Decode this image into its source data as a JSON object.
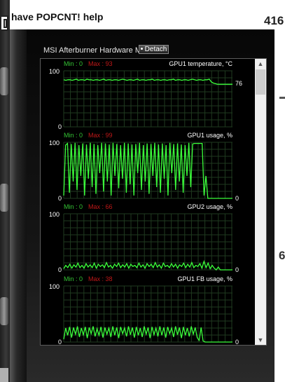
{
  "page": {
    "title": "have POPCNT! help",
    "page_number": "416",
    "side_mark": "6"
  },
  "monitor": {
    "title": "MSI Afterburner Hardware Monitor",
    "detach_label": "Detach",
    "colors": {
      "line": "#3bff3b",
      "grid": "#1f3a1f",
      "min_text": "#34c334",
      "max_text": "#c01818",
      "label": "#ffffff"
    }
  },
  "chart_data": [
    {
      "type": "line",
      "title": "GPU1 temperature, °C",
      "min_label": "Min : 0",
      "max_label": "Max : 93",
      "y_top_label": "100",
      "y_bottom_label": "0",
      "current_value_label": "76",
      "ylim": [
        0,
        100
      ],
      "values": [
        84,
        83,
        84,
        84,
        83,
        84,
        85,
        83,
        84,
        84,
        83,
        85,
        84,
        84,
        83,
        84,
        84,
        83,
        84,
        85,
        83,
        84,
        84,
        83,
        84,
        84,
        83,
        84,
        85,
        84,
        83,
        84,
        84,
        83,
        84,
        85,
        83,
        84,
        84,
        83,
        84,
        84,
        85,
        83,
        84,
        84,
        83,
        84,
        84,
        83,
        84,
        84,
        85,
        83,
        84,
        84,
        83,
        84,
        84,
        83,
        84,
        85,
        84,
        83,
        84,
        84,
        83,
        84,
        84,
        85,
        80,
        78,
        77,
        76,
        76,
        76,
        76,
        76,
        76,
        76,
        76
      ]
    },
    {
      "type": "line",
      "title": "GPU1 usage, %",
      "min_label": "Min : 0",
      "max_label": "Max : 99",
      "y_top_label": "100",
      "y_bottom_label": "0",
      "current_value_label": "0",
      "ylim": [
        0,
        100
      ],
      "values": [
        5,
        95,
        98,
        10,
        97,
        30,
        99,
        15,
        95,
        40,
        98,
        5,
        96,
        35,
        99,
        20,
        97,
        8,
        95,
        45,
        99,
        12,
        98,
        30,
        96,
        5,
        99,
        40,
        97,
        18,
        95,
        35,
        99,
        10,
        98,
        25,
        96,
        5,
        97,
        45,
        99,
        15,
        95,
        30,
        98,
        8,
        97,
        40,
        99,
        20,
        96,
        10,
        98,
        35,
        95,
        5,
        99,
        45,
        97,
        15,
        98,
        30,
        96,
        10,
        95,
        40,
        99,
        20,
        97,
        98,
        98,
        98,
        98,
        98,
        5,
        40,
        0,
        0,
        0,
        0,
        0,
        0,
        0,
        0,
        0,
        0,
        0,
        0,
        0,
        0
      ]
    },
    {
      "type": "line",
      "title": "GPU2 usage, %",
      "min_label": "Min : 0",
      "max_label": "Max : 66",
      "y_top_label": "100",
      "y_bottom_label": "0",
      "current_value_label": "0",
      "ylim": [
        0,
        100
      ],
      "values": [
        2,
        8,
        4,
        10,
        3,
        9,
        5,
        12,
        4,
        8,
        3,
        11,
        5,
        9,
        4,
        12,
        3,
        10,
        6,
        9,
        4,
        13,
        5,
        8,
        3,
        10,
        6,
        12,
        4,
        9,
        5,
        11,
        3,
        10,
        6,
        8,
        4,
        12,
        5,
        9,
        3,
        11,
        6,
        10,
        4,
        13,
        5,
        9,
        3,
        12,
        6,
        8,
        4,
        11,
        5,
        10,
        3,
        9,
        6,
        12,
        4,
        10,
        5,
        13,
        4,
        8,
        6,
        11,
        3,
        15,
        4,
        12,
        2,
        8,
        3,
        0,
        5,
        0,
        0,
        0,
        0,
        0,
        0,
        0
      ]
    },
    {
      "type": "line",
      "title": "GPU1 FB usage, %",
      "min_label": "Min : 0",
      "max_label": "Max : 38",
      "y_top_label": "100",
      "y_bottom_label": "0",
      "current_value_label": "0",
      "ylim": [
        0,
        100
      ],
      "values": [
        5,
        25,
        12,
        27,
        8,
        26,
        14,
        28,
        9,
        25,
        13,
        27,
        7,
        26,
        15,
        28,
        10,
        24,
        12,
        27,
        8,
        26,
        14,
        25,
        9,
        28,
        12,
        26,
        7,
        27,
        15,
        25,
        10,
        28,
        13,
        26,
        8,
        27,
        12,
        25,
        9,
        28,
        14,
        26,
        7,
        27,
        13,
        25,
        10,
        28,
        12,
        26,
        8,
        27,
        15,
        25,
        9,
        28,
        13,
        26,
        7,
        27,
        12,
        25,
        10,
        28,
        14,
        26,
        8,
        3,
        26,
        2,
        0,
        0,
        0,
        0,
        0,
        0,
        0,
        0,
        0,
        0,
        0,
        0,
        0,
        0,
        0
      ]
    }
  ]
}
